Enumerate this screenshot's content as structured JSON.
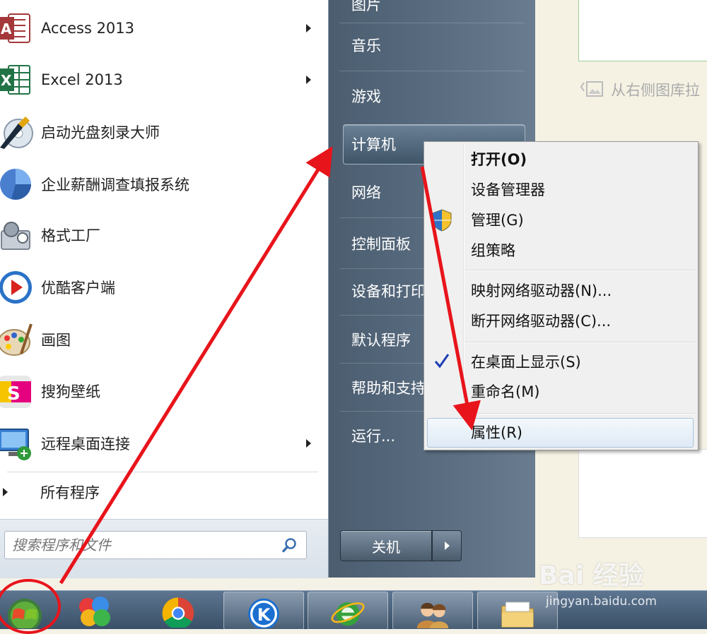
{
  "background_doc": {
    "hint_text": "从右侧图库拉"
  },
  "start_menu": {
    "programs": [
      {
        "label": "Access 2013",
        "icon": "access-icon",
        "has_submenu": true
      },
      {
        "label": "Excel 2013",
        "icon": "excel-icon",
        "has_submenu": true
      },
      {
        "label": "启动光盘刻录大师",
        "icon": "disc-burner-icon",
        "has_submenu": false
      },
      {
        "label": "企业薪酬调查填报系统",
        "icon": "salary-survey-icon",
        "has_submenu": false
      },
      {
        "label": "格式工厂",
        "icon": "format-factory-icon",
        "has_submenu": false
      },
      {
        "label": "优酷客户端",
        "icon": "youku-icon",
        "has_submenu": false
      },
      {
        "label": "画图",
        "icon": "paint-icon",
        "has_submenu": false
      },
      {
        "label": "搜狗壁纸",
        "icon": "sogou-wallpaper-icon",
        "has_submenu": false
      },
      {
        "label": "远程桌面连接",
        "icon": "remote-desktop-icon",
        "has_submenu": true
      }
    ],
    "all_programs": "所有程序",
    "search_placeholder": "搜索程序和文件",
    "right_items": {
      "top_partial": "图片",
      "music": "音乐",
      "games": "游戏",
      "computer": "计算机",
      "network": "网络",
      "control_panel": "控制面板",
      "devices_printers": "设备和打印",
      "default_programs": "默认程序",
      "help_support": "帮助和支持",
      "run": "运行..."
    },
    "shutdown_label": "关机"
  },
  "context_menu": {
    "items": {
      "open": "打开(O)",
      "device_manager": "设备管理器",
      "manage": "管理(G)",
      "group_policy": "组策略",
      "map_drive": "映射网络驱动器(N)...",
      "disconnect_drive": "断开网络驱动器(C)...",
      "show_desktop": "在桌面上显示(S)",
      "rename": "重命名(M)",
      "properties": "属性(R)"
    },
    "show_desktop_checked": true
  },
  "taskbar": {
    "apps": [
      "windows-start-orb",
      "pinwheel-app-icon",
      "chrome-icon",
      "kugou-icon",
      "ie-icon",
      "users-icon",
      "folder-icon"
    ]
  },
  "watermark": {
    "brand": "Bai 经验",
    "url": "jingyan.baidu.com"
  },
  "colors": {
    "annotation_red": "#e8141b",
    "right_pane": "#56697c",
    "taskbar": "#4a6078"
  }
}
